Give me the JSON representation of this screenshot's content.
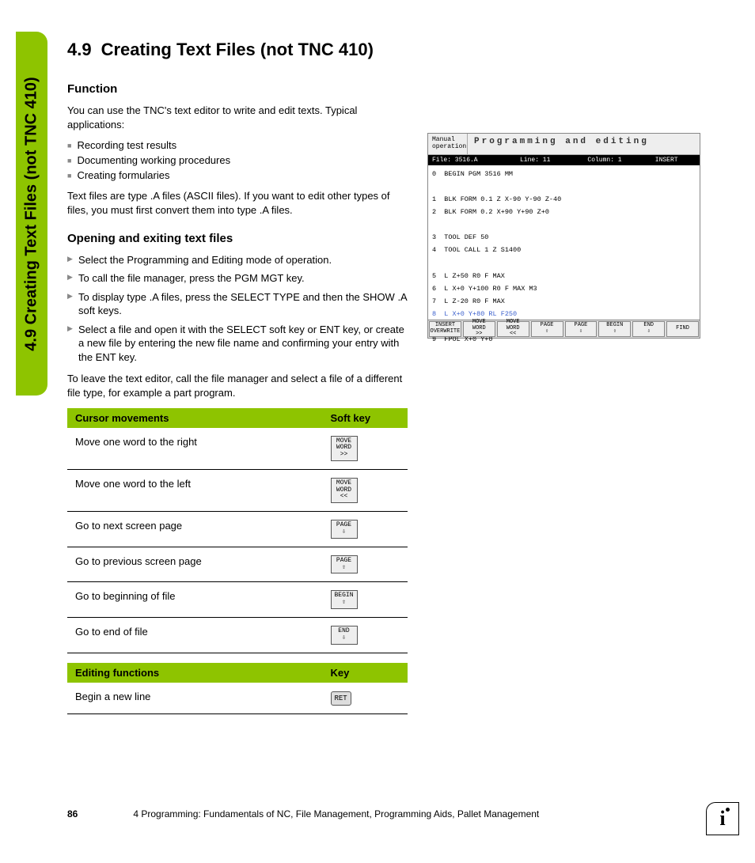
{
  "sideTab": "4.9 Creating Text Files (not TNC 410)",
  "heading": {
    "num": "4.9",
    "title": "Creating Text Files (not TNC 410)"
  },
  "function": {
    "heading": "Function",
    "intro": "You can use the TNC's text editor to write and edit texts. Typical applications:",
    "bullets": [
      "Recording test results",
      "Documenting working procedures",
      "Creating formularies"
    ],
    "note": "Text files are type .A files (ASCII files). If you want to edit other types of files, you must first convert them into type .A files."
  },
  "opening": {
    "heading": "Opening and exiting text files",
    "steps": [
      "Select the Programming and Editing mode of operation.",
      "To call the file manager, press the PGM MGT key.",
      "To display type .A files, press the SELECT TYPE and then the SHOW .A soft keys.",
      "Select a file and open it with the SELECT soft key or ENT key, or create a new file by entering the new file name and confirming your entry with the ENT key."
    ],
    "leave": "To leave the text editor, call the file manager and select a file of a different file type, for example a part program."
  },
  "table1": {
    "headers": [
      "Cursor movements",
      "Soft key"
    ],
    "rows": [
      {
        "label": "Move one word to the right",
        "key": {
          "l1": "MOVE",
          "l2": "WORD",
          "l3": ">>"
        }
      },
      {
        "label": "Move one word to the left",
        "key": {
          "l1": "MOVE",
          "l2": "WORD",
          "l3": "<<"
        }
      },
      {
        "label": "Go to next screen page",
        "key": {
          "l1": "PAGE",
          "l2": "⇩",
          "l3": ""
        }
      },
      {
        "label": "Go to previous screen page",
        "key": {
          "l1": "PAGE",
          "l2": "⇧",
          "l3": ""
        }
      },
      {
        "label": "Go to beginning of file",
        "key": {
          "l1": "BEGIN",
          "l2": "⇧",
          "l3": ""
        }
      },
      {
        "label": "Go to end of file",
        "key": {
          "l1": "END",
          "l2": "⇩",
          "l3": ""
        }
      }
    ]
  },
  "table2": {
    "headers": [
      "Editing functions",
      "Key"
    ],
    "rows": [
      {
        "label": "Begin a new line",
        "key": "RET"
      }
    ]
  },
  "screenshot": {
    "mode": "Manual operation",
    "title": "Programming and editing",
    "status": {
      "file": "File: 3516.A",
      "line": "Line: 11",
      "col": "Column: 1",
      "mode": "INSERT"
    },
    "lines": [
      "0  BEGIN PGM 3516 MM",
      "",
      "1  BLK FORM 0.1 Z X-90 Y-90 Z-40",
      "2  BLK FORM 0.2 X+90 Y+90 Z+0",
      "",
      "3  TOOL DEF 50",
      "4  TOOL CALL 1 Z S1400",
      "",
      "5  L Z+50 R0 F MAX",
      "6  L X+0 Y+100 R0 F MAX M3",
      "7  L Z-20 R0 F MAX",
      "8  L X+0 Y+80 RL F250",
      "",
      "9  FPOL X+0 Y+0"
    ],
    "hlIndex": 11,
    "softkeys": [
      {
        "l1": "INSERT",
        "l2": "OVERWRITE"
      },
      {
        "l1": "MOVE",
        "l2": "WORD",
        "l3": ">>"
      },
      {
        "l1": "MOVE",
        "l2": "WORD",
        "l3": "<<"
      },
      {
        "l1": "PAGE",
        "l2": "⇧"
      },
      {
        "l1": "PAGE",
        "l2": "⇩"
      },
      {
        "l1": "BEGIN",
        "l2": "⇧"
      },
      {
        "l1": "END",
        "l2": "⇩"
      },
      {
        "l1": "FIND",
        "l2": ""
      }
    ]
  },
  "footer": {
    "page": "86",
    "chapter": "4 Programming: Fundamentals of NC, File Management, Programming Aids, Pallet Management"
  },
  "infoIcon": "i"
}
